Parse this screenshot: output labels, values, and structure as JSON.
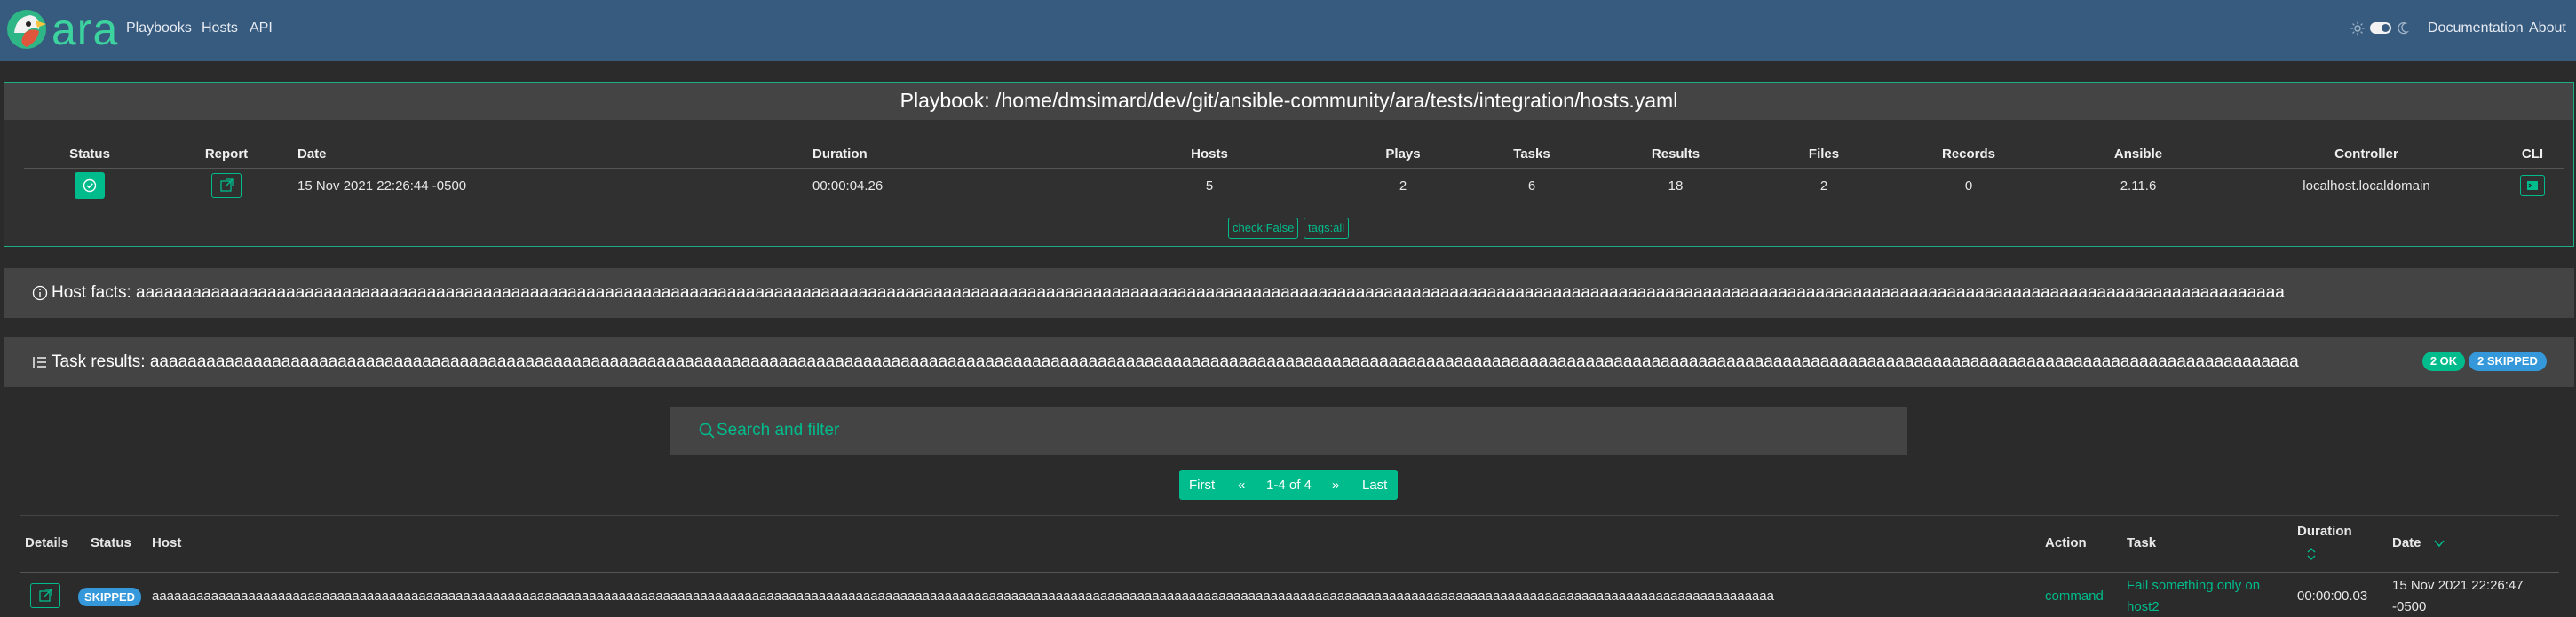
{
  "nav": {
    "brand": "ara",
    "links": [
      "Playbooks",
      "Hosts",
      "API"
    ],
    "right_links": [
      "Documentation",
      "About"
    ]
  },
  "playbook": {
    "title": "Playbook: /home/dmsimard/dev/git/ansible-community/ara/tests/integration/hosts.yaml",
    "headers": [
      "Status",
      "Report",
      "Date",
      "Duration",
      "Hosts",
      "Plays",
      "Tasks",
      "Results",
      "Files",
      "Records",
      "Ansible",
      "Controller",
      "CLI"
    ],
    "row": {
      "date": "15 Nov 2021 22:26:44 -0500",
      "duration": "00:00:04.26",
      "hosts": "5",
      "plays": "2",
      "tasks": "6",
      "results": "18",
      "files": "2",
      "records": "0",
      "ansible": "2.11.6",
      "controller": "localhost.localdomain"
    },
    "tags": [
      "check:False",
      "tags:all"
    ]
  },
  "host_facts": {
    "label": "Host facts: aaaaaaaaaaaaaaaaaaaaaaaaaaaaaaaaaaaaaaaaaaaaaaaaaaaaaaaaaaaaaaaaaaaaaaaaaaaaaaaaaaaaaaaaaaaaaaaaaaaaaaaaaaaaaaaaaaaaaaaaaaaaaaaaaaaaaaaaaaaaaaaaaaaaaaaaaaaaaaaaaaaaaaaaaaaaaaaaaaaaaaaaaaaaaaaaaaaaaaaaaaaaaaaaaaaaaaaaaaaaaaaaaaaaa"
  },
  "task_results": {
    "label": "Task results: aaaaaaaaaaaaaaaaaaaaaaaaaaaaaaaaaaaaaaaaaaaaaaaaaaaaaaaaaaaaaaaaaaaaaaaaaaaaaaaaaaaaaaaaaaaaaaaaaaaaaaaaaaaaaaaaaaaaaaaaaaaaaaaaaaaaaaaaaaaaaaaaaaaaaaaaaaaaaaaaaaaaaaaaaaaaaaaaaaaaaaaaaaaaaaaaaaaaaaaaaaaaaaaaaaaaaaaaaaaaaaaaaaaaa",
    "ok_badge": "2 OK",
    "skipped_badge": "2 SKIPPED",
    "search_placeholder": "Search and filter",
    "pager": {
      "first": "First",
      "prev": "«",
      "range": "1-4 of 4",
      "next": "»",
      "last": "Last"
    },
    "headers": {
      "details": "Details",
      "status": "Status",
      "host": "Host",
      "action": "Action",
      "task": "Task",
      "duration": "Duration",
      "date": "Date"
    },
    "rows": [
      {
        "status": "SKIPPED",
        "host": "aaaaaaaaaaaaaaaaaaaaaaaaaaaaaaaaaaaaaaaaaaaaaaaaaaaaaaaaaaaaaaaaaaaaaaaaaaaaaaaaaaaaaaaaaaaaaaaaaaaaaaaaaaaaaaaaaaaaaaaaaaaaaaaaaaaaaaaaaaaaaaaaaaaaaaaaaaaaaaaaaaaaaaaaaaaaaaaaaaaaaaaaaaaaaaaaaaaaaaaaaaaaaaaaaaaaaaaaaaa",
        "action": "command",
        "task_line1": "Fail something only on",
        "task_line2": "host2",
        "duration": "00:00:00.03",
        "date_line1": "15 Nov 2021 22:26:47",
        "date_line2": "-0500"
      }
    ]
  },
  "colors": {
    "navbar": "#375a7f",
    "accent": "#00bc8c",
    "skipped": "#3498db",
    "background": "#2b2b2b"
  }
}
